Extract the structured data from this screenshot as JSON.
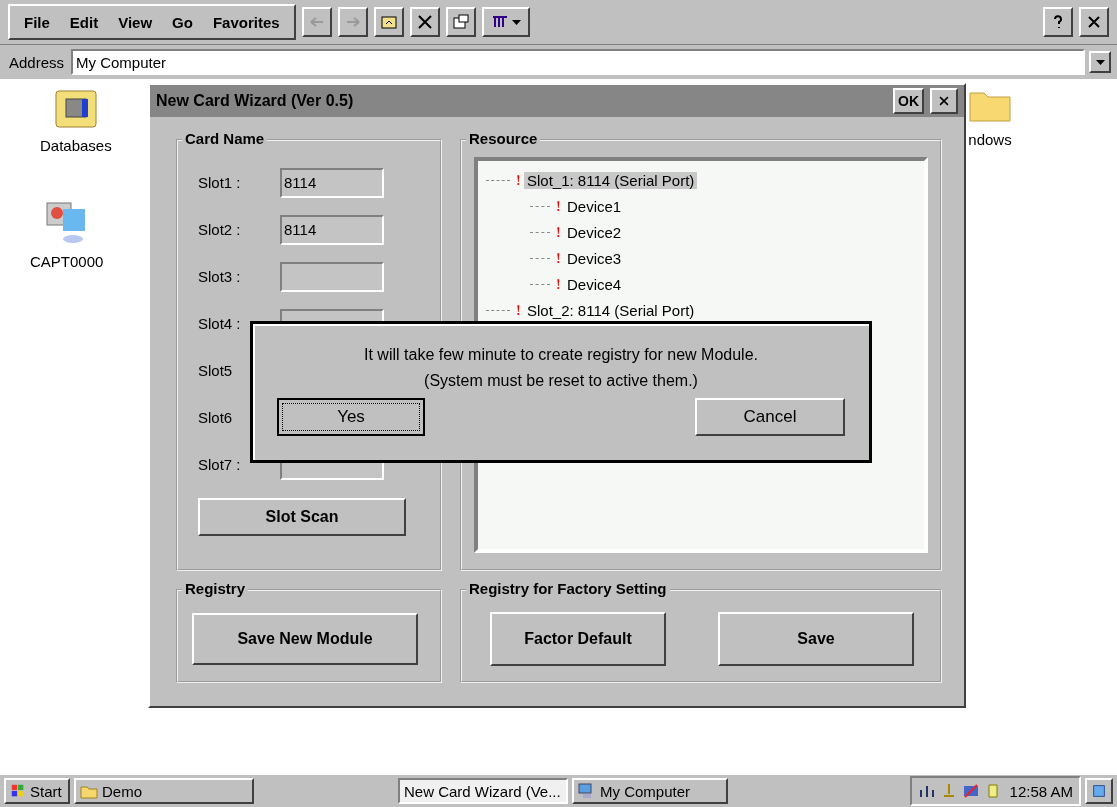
{
  "menu": [
    {
      "label": "File"
    },
    {
      "label": "Edit"
    },
    {
      "label": "View"
    },
    {
      "label": "Go"
    },
    {
      "label": "Favorites"
    }
  ],
  "address": {
    "label": "Address",
    "value": "My Computer"
  },
  "desktop_icons": [
    {
      "label": "Databases",
      "kind": "database"
    },
    {
      "label": "CAPT0000",
      "kind": "computer"
    },
    {
      "label": "ndows",
      "kind": "folder"
    }
  ],
  "dialog": {
    "title": "New Card Wizard (Ver 0.5)",
    "ok": "OK",
    "card_name": {
      "title": "Card Name",
      "slots": [
        {
          "label": "Slot1 :",
          "value": "8114"
        },
        {
          "label": "Slot2 :",
          "value": "8114"
        },
        {
          "label": "Slot3 :"
        },
        {
          "label": "Slot4 :"
        },
        {
          "label": "Slot5"
        },
        {
          "label": "Slot6"
        },
        {
          "label": "Slot7 :"
        }
      ],
      "scan": "Slot Scan"
    },
    "resource": {
      "title": "Resource",
      "tree": [
        {
          "label": "Slot_1: 8114 (Serial Port)",
          "selected": true,
          "children": [
            {
              "label": "Device1",
              "selected": false
            },
            {
              "label": "Device2",
              "selected": false
            },
            {
              "label": "Device3",
              "selected": false
            },
            {
              "label": "Device4",
              "selected": false
            }
          ]
        },
        {
          "label": "Slot_2: 8114 (Serial Port)",
          "selected": false
        }
      ]
    },
    "registry": {
      "title": "Registry",
      "button": "Save New Module"
    },
    "factory": {
      "title": "Registry for Factory Setting",
      "buttons": [
        "Factor Default",
        "Save"
      ]
    }
  },
  "message": {
    "lines": [
      "It will take few minute to create registry for new Module.",
      "(System must be reset to active them.)"
    ],
    "buttons": [
      {
        "label": "Yes",
        "selected": true
      },
      {
        "label": "Cancel",
        "selected": false
      }
    ]
  },
  "taskbar": {
    "start": "Start",
    "tasks": [
      {
        "label": "Demo",
        "selected": false,
        "kind": "folder"
      },
      {
        "label": "New Card Wizard (Ve...",
        "selected": true,
        "kind": "none"
      },
      {
        "label": "My Computer",
        "selected": false,
        "kind": "computer"
      }
    ],
    "clock": "12:58 AM"
  }
}
